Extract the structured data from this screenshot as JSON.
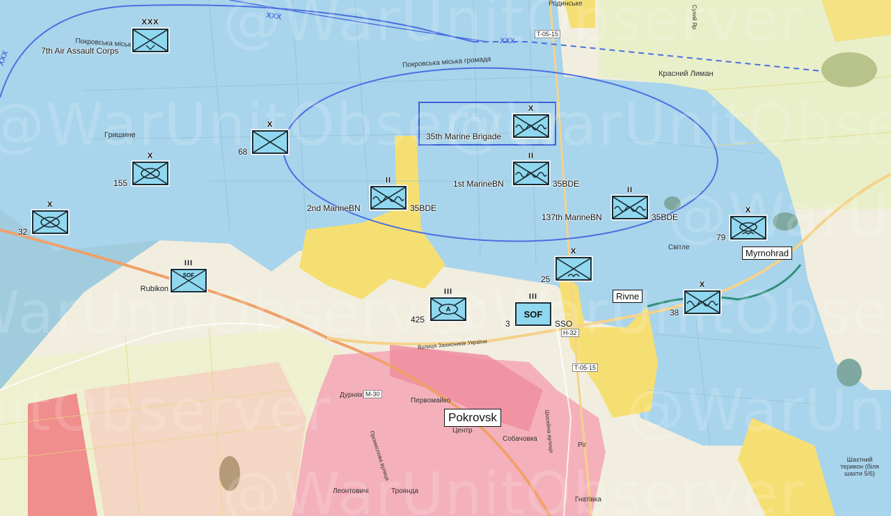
{
  "watermark": "@WarUnitObserver",
  "colors": {
    "ukraine_control": "#a8d4ec",
    "russian_control": "#f4a7b4",
    "contested": "#f7e07a",
    "unit_fill": "#8fd8ef",
    "outline_blue": "#4a6fe0"
  },
  "cities": [
    {
      "label": "Pokrovsk"
    },
    {
      "label": "Myrnohrad"
    },
    {
      "label": "Rivne"
    }
  ],
  "places": [
    {
      "label": "Родинське"
    },
    {
      "label": "Покровська міська громада"
    },
    {
      "label": "Покровська міська громада"
    },
    {
      "label": "Красний Лиман"
    },
    {
      "label": "Гришине"
    },
    {
      "label": "Світле"
    },
    {
      "label": "Первомайко"
    },
    {
      "label": "Дурнях"
    },
    {
      "label": "Центр"
    },
    {
      "label": "Собачовка"
    },
    {
      "label": "Ріг"
    },
    {
      "label": "Леонтовичі"
    },
    {
      "label": "Троянда"
    },
    {
      "label": "Гнатівка"
    },
    {
      "label": "Шахтний терикон (біля шахти 5/6)"
    },
    {
      "label": "Сухий Яр"
    },
    {
      "label": "Вулиця Захисників України"
    },
    {
      "label": "Шосейна вулиця"
    },
    {
      "label": "Промислова вулиця"
    }
  ],
  "roads": [
    {
      "label": "T-05-15"
    },
    {
      "label": "T-05-15"
    },
    {
      "label": "H-32"
    },
    {
      "label": "M-30"
    }
  ],
  "echelons": {
    "corps": "XXX",
    "brigade": "X",
    "regiment": "III",
    "battalion": "II"
  },
  "units": [
    {
      "name": "7th Air Assault Corps",
      "type": "infantry",
      "echelon": "XXX"
    },
    {
      "name": "68",
      "type": "infantry",
      "echelon": "X"
    },
    {
      "name": "155",
      "type": "mechanized",
      "echelon": "X"
    },
    {
      "name": "32",
      "type": "mechanized",
      "echelon": "X"
    },
    {
      "name": "35th Marine Brigade",
      "type": "marine",
      "echelon": "X"
    },
    {
      "name": "1st MarineBN",
      "sub": "35BDE",
      "type": "marine",
      "echelon": "II"
    },
    {
      "name": "2nd MarineBN",
      "sub": "35BDE",
      "type": "marine",
      "echelon": "II"
    },
    {
      "name": "137th MarineBN",
      "sub": "35BDE",
      "type": "marine",
      "echelon": "II"
    },
    {
      "name": "79",
      "type": "air-assault",
      "echelon": "X"
    },
    {
      "name": "25",
      "type": "airborne",
      "echelon": "X"
    },
    {
      "name": "425",
      "type": "assault",
      "echelon": "III",
      "mark": "A"
    },
    {
      "name": "3",
      "sub": "SSO",
      "type": "sof",
      "echelon": "III",
      "mark": "SOF"
    },
    {
      "name": "Rubikon",
      "type": "sof",
      "echelon": "III",
      "mark": "SOF"
    },
    {
      "name": "38",
      "type": "marine",
      "echelon": "X"
    }
  ]
}
